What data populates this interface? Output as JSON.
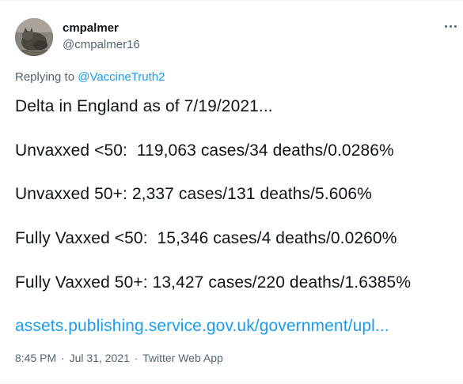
{
  "author": {
    "display_name": "cmpalmer",
    "handle": "@cmpalmer16",
    "avatar_icon": "profile-photo"
  },
  "more_icon": "ellipsis-icon",
  "reply_context": {
    "prefix": "Replying to",
    "mention": "@VaccineTruth2"
  },
  "tweet": {
    "lines": [
      "Delta in England as of 7/19/2021...",
      "Unvaxxed <50:  119,063 cases/34 deaths/0.0286%",
      "Unvaxxed 50+: 2,337 cases/131 deaths/5.606%",
      "Fully Vaxxed <50:  15,346 cases/4 deaths/0.0260%",
      "Fully Vaxxed 50+: 13,427 cases/220 deaths/1.6385%"
    ],
    "link": "assets.publishing.service.gov.uk/government/upl..."
  },
  "meta": {
    "time": "8:45 PM",
    "date": "Jul 31, 2021",
    "separator": "·",
    "source": "Twitter Web App"
  },
  "colors": {
    "text": "#0f1419",
    "secondary": "#536471",
    "link": "#1d9bf0",
    "divider": "#eff3f4"
  }
}
